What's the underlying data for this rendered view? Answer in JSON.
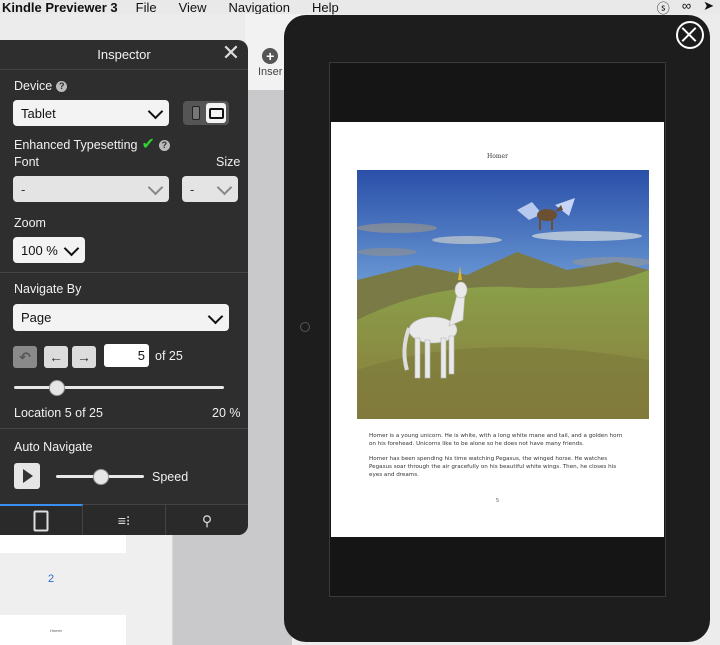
{
  "menubar": {
    "app_name": "Kindle Previewer 3",
    "items": [
      "File",
      "View",
      "Navigation",
      "Help"
    ]
  },
  "toolbar": {
    "insert_label": "Inser"
  },
  "thumbnails": {
    "page_number": "2",
    "tiny_title": "Homer"
  },
  "inspector": {
    "title": "Inspector",
    "device_label": "Device",
    "device_value": "Tablet",
    "enhanced_typesetting_label": "Enhanced Typesetting",
    "font_label": "Font",
    "size_label": "Size",
    "font_value": "-",
    "size_value": "-",
    "zoom_label": "Zoom",
    "zoom_value": "100 %",
    "navigate_by_label": "Navigate By",
    "navigate_by_value": "Page",
    "page_field_value": "5",
    "page_of_text": "of  25",
    "location_text": "Location 5 of 25",
    "location_percent": "20 %",
    "location_fraction": 0.2,
    "auto_navigate_label": "Auto Navigate",
    "speed_label": "Speed",
    "speed_level": 0.5
  },
  "book": {
    "page_title": "Homer",
    "paragraph1": "Homer is a young unicorn.  He is white, with a long white mane and tail, and a golden horn on his forehead.  Unicorns like to be alone so he does not have many friends.",
    "paragraph2": "Homer has been spending his time watching Pegasus, the winged horse.  He watches Pegasus soar through the air gracefully on his beautiful white wings.  Then, he closes his eyes and dreams.",
    "page_number": "5"
  },
  "colors": {
    "accent": "#3a8ff0",
    "check": "#2fd12f",
    "panel": "#2e2e2e"
  }
}
